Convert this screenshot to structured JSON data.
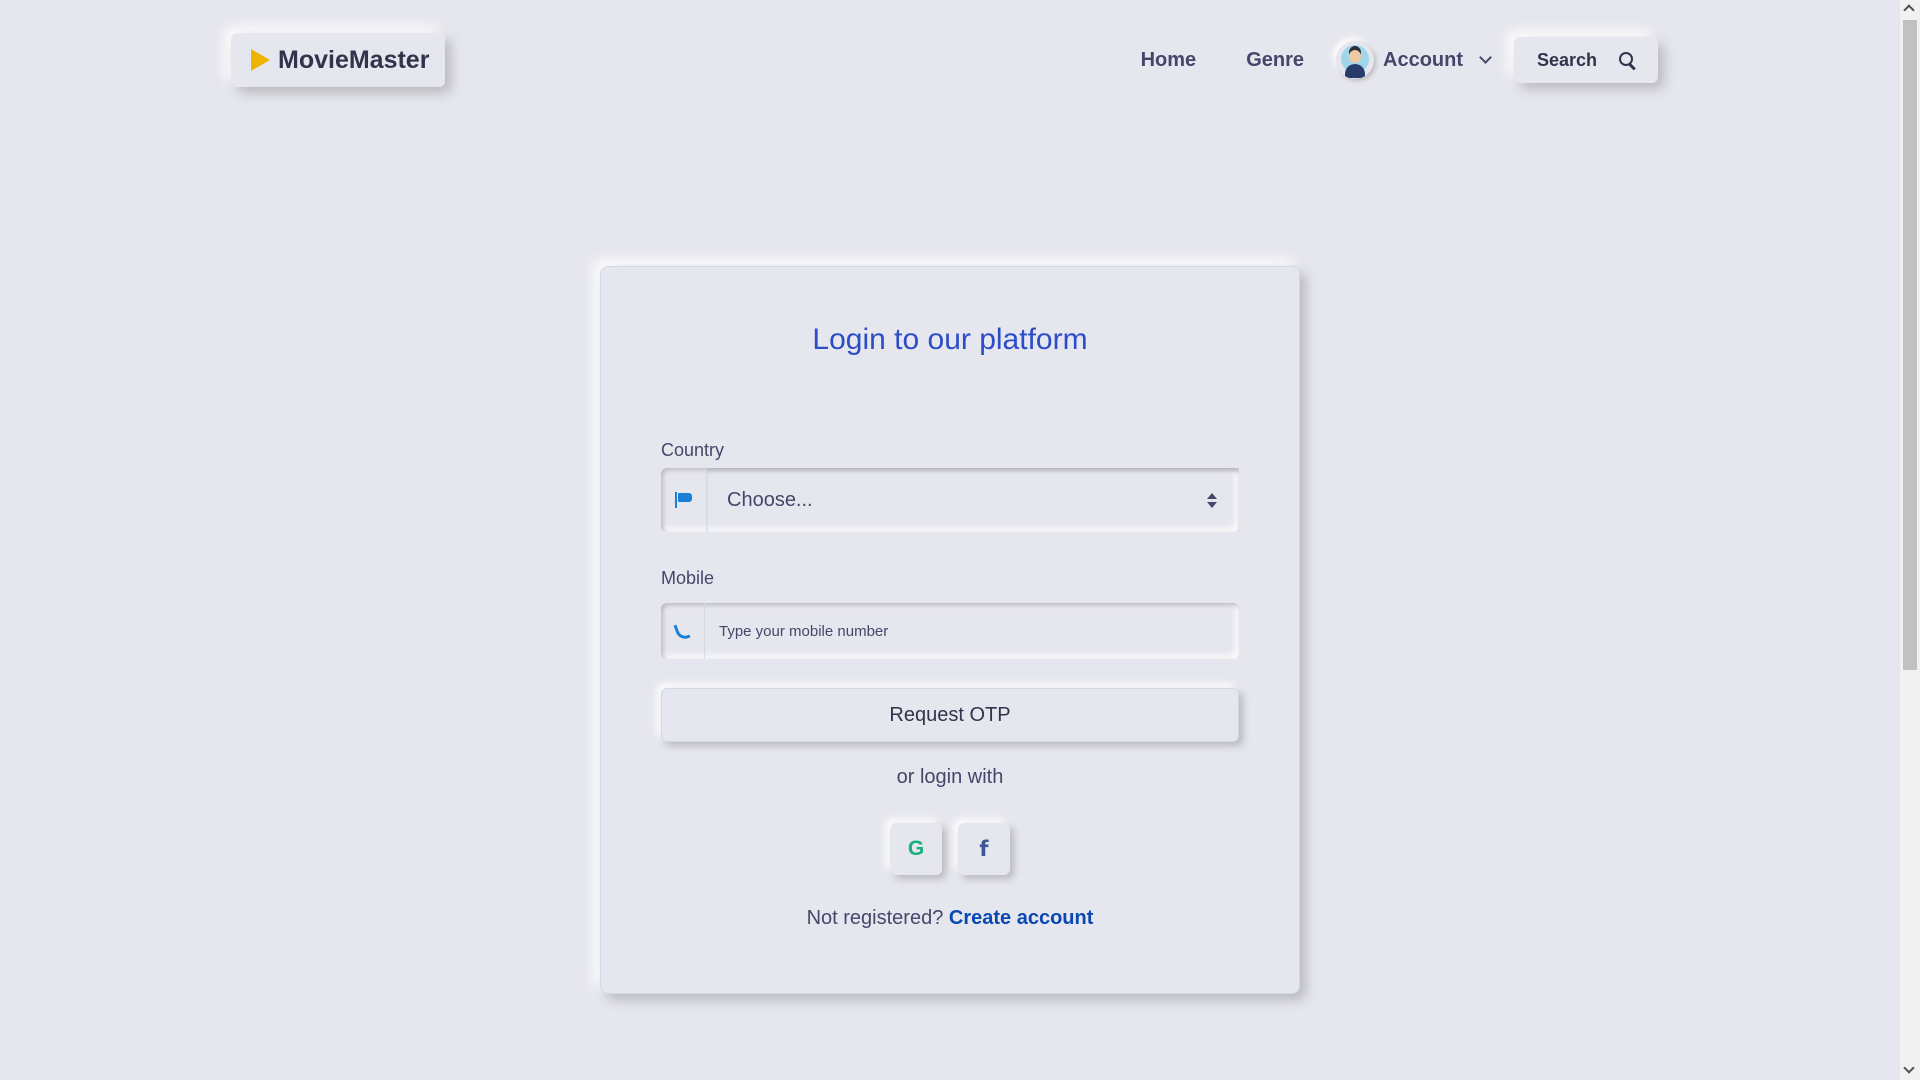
{
  "navbar": {
    "brand": "MovieMaster",
    "links": {
      "home": "Home",
      "genre": "Genre"
    },
    "account_label": "Account",
    "search_label": "Search"
  },
  "login": {
    "title": "Login to our platform",
    "country_label": "Country",
    "country_selected": "Choose...",
    "mobile_label": "Mobile",
    "mobile_placeholder": "Type your mobile number",
    "otp_button": "Request OTP",
    "or_text": "or login with",
    "social": {
      "google": "G",
      "facebook": "f"
    },
    "register_text": "Not registered?",
    "register_link": "Create account"
  },
  "colors": {
    "background": "#e6e7ee",
    "title": "#2d4cc8",
    "link": "#0948b3",
    "brand_icon": "#f0b400",
    "icon_blue": "#1a7fd6",
    "google": "#18b07a",
    "facebook": "#3b5998"
  },
  "icons": {
    "brand": "play-icon",
    "country_field": "flag-icon",
    "mobile_field": "phone-icon",
    "search": "search-icon",
    "account_menu": "chevron-down-icon"
  }
}
